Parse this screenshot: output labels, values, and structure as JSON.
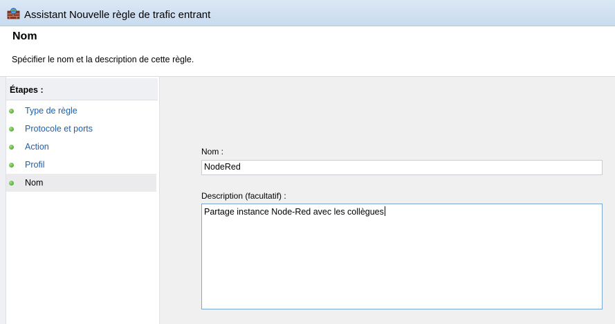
{
  "window": {
    "title": "Assistant Nouvelle règle de trafic entrant",
    "icon": "firewall-icon"
  },
  "header": {
    "heading": "Nom",
    "subtitle": "Spécifier le nom et la description de cette règle."
  },
  "steps": {
    "heading": "Étapes :",
    "items": [
      {
        "label": "Type de règle",
        "status": "completed"
      },
      {
        "label": "Protocole et ports",
        "status": "completed"
      },
      {
        "label": "Action",
        "status": "completed"
      },
      {
        "label": "Profil",
        "status": "completed"
      },
      {
        "label": "Nom",
        "status": "current"
      }
    ]
  },
  "form": {
    "name_label": "Nom :",
    "name_value": "NodeRed",
    "description_label": "Description (facultatif) :",
    "description_value": "Partage instance Node-Red avec les collègues"
  },
  "colors": {
    "link": "#1a5fb4",
    "step_dot": "#3fa82a",
    "focus_border": "#7aa7d6"
  }
}
